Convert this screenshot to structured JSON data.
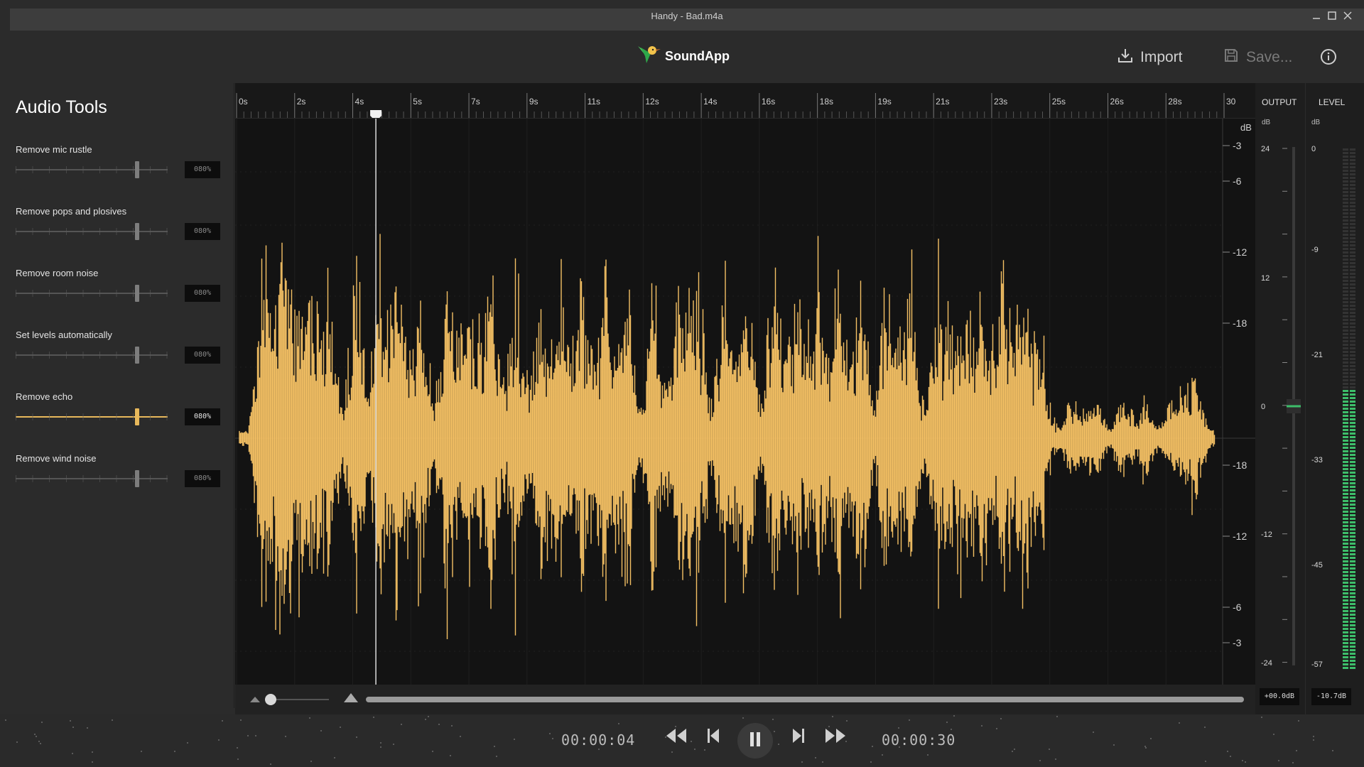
{
  "window": {
    "title": "Handy - Bad.m4a"
  },
  "app": {
    "name": "SoundApp",
    "import_label": "Import",
    "save_label": "Save..."
  },
  "sidebar": {
    "heading": "Audio Tools",
    "tools": [
      {
        "label": "Remove mic rustle",
        "value": "080%",
        "active": false
      },
      {
        "label": "Remove pops and plosives",
        "value": "080%",
        "active": false
      },
      {
        "label": "Remove room noise",
        "value": "080%",
        "active": false
      },
      {
        "label": "Set levels automatically",
        "value": "080%",
        "active": false
      },
      {
        "label": "Remove echo",
        "value": "080%",
        "active": true
      },
      {
        "label": "Remove wind noise",
        "value": "080%",
        "active": false
      }
    ]
  },
  "waveform": {
    "ruler_labels": [
      "0s",
      "2s",
      "4s",
      "5s",
      "7s",
      "9s",
      "11s",
      "12s",
      "14s",
      "16s",
      "18s",
      "19s",
      "21s",
      "23s",
      "25s",
      "26s",
      "28s",
      "30"
    ],
    "db_unit": "dB",
    "db_labels": [
      "-3",
      "-6",
      "-12",
      "-18",
      "-18",
      "-12",
      "-6",
      "-3"
    ],
    "playhead_seconds": 4.6,
    "colors": {
      "wave": "#f4c064",
      "background": "#131313"
    }
  },
  "output_meter": {
    "heading": "OUTPUT",
    "unit": "dB",
    "labels": [
      "24",
      "12",
      "0",
      "-12",
      "-24"
    ],
    "readout": "+00.0dB",
    "level_fraction": 0.5
  },
  "level_meter": {
    "heading": "LEVEL",
    "unit": "dB",
    "labels": [
      "0",
      "-9",
      "-21",
      "-33",
      "-45",
      "-57"
    ],
    "readout": "-10.7dB",
    "color": "#3dbe6a"
  },
  "transport": {
    "current_time": "00:00:04",
    "total_time": "00:00:30"
  }
}
